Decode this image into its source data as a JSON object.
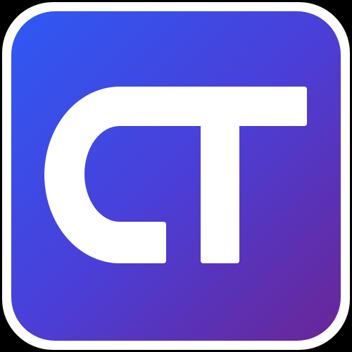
{
  "icon": {
    "name": "ct-app-icon",
    "logo_lettering": "CT",
    "colors": {
      "gradient_start": "#2E59F4",
      "gradient_mid": "#4A3FD8",
      "gradient_end": "#6A2596",
      "glyph": "#FFFFFF",
      "frame": "#FFFFFF",
      "background": "#000000"
    }
  }
}
